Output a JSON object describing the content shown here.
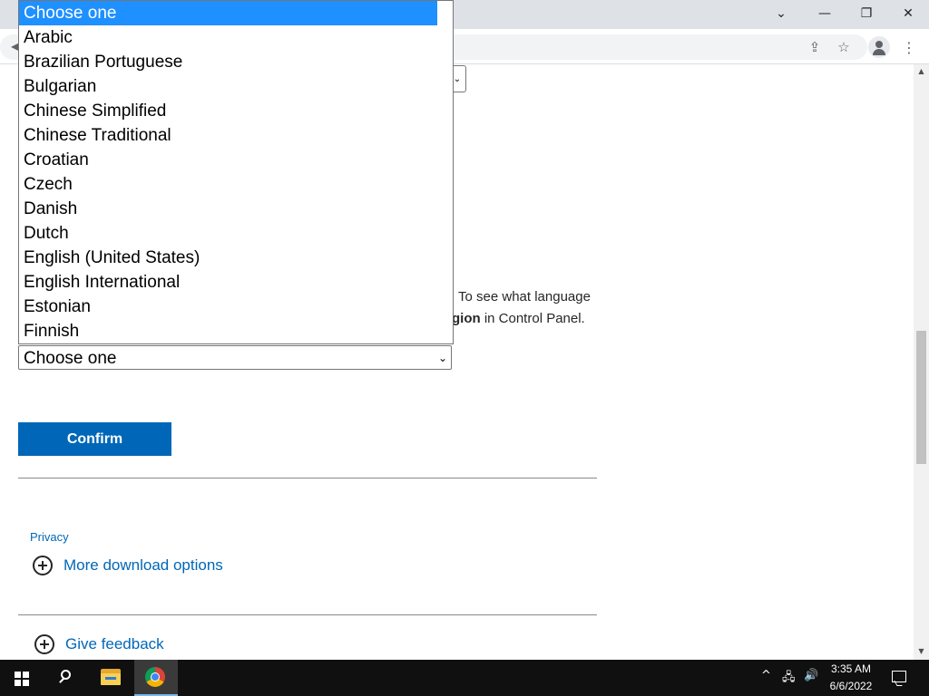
{
  "window": {
    "tab_search_icon": "chevron-down-icon",
    "minimize_glyph": "—",
    "maximize_glyph": "❐",
    "close_glyph": "✕"
  },
  "toolbar": {
    "back_glyph": "◀",
    "share_glyph": "⇪",
    "star_glyph": "☆",
    "menu_glyph": "⋮"
  },
  "page": {
    "partial_select_glyph": "⌄",
    "info_line1": "To see what language",
    "info_line2_bold": "gion",
    "info_line2_rest": " in Control Panel.",
    "language_select": {
      "value": "Choose one",
      "options": [
        "Choose one",
        "Arabic",
        "Brazilian Portuguese",
        "Bulgarian",
        "Chinese Simplified",
        "Chinese Traditional",
        "Croatian",
        "Czech",
        "Danish",
        "Dutch",
        "English (United States)",
        "English International",
        "Estonian",
        "Finnish"
      ],
      "selected_index": 0
    },
    "confirm_label": "Confirm",
    "privacy_label": "Privacy",
    "more_download_label": "More download options",
    "give_feedback_label": "Give feedback"
  },
  "taskbar": {
    "time": "3:35 AM",
    "date": "6/6/2022",
    "tray_chevron": "^",
    "network_glyph": "🖧",
    "volume_glyph": "🔊"
  },
  "colors": {
    "accent": "#0067b8",
    "selected_option": "#1e90ff",
    "taskbar": "#101010"
  }
}
